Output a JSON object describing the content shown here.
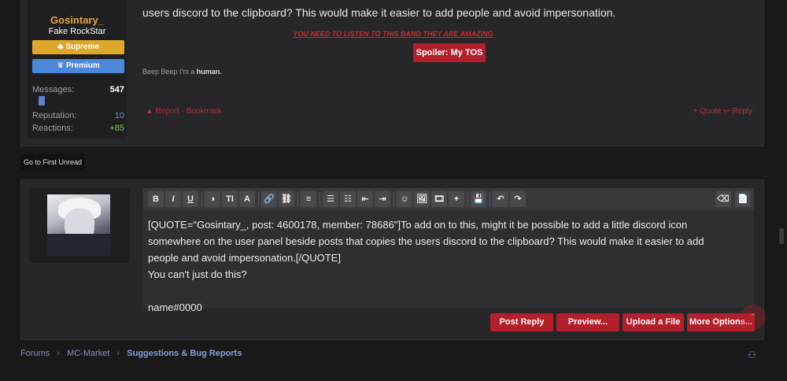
{
  "post": {
    "user": {
      "name": "Gosintary_",
      "title": "Fake RockStar",
      "badges": [
        {
          "label": "Supreme",
          "icon": "diamond-icon"
        },
        {
          "label": "Premium",
          "icon": "trophy-icon"
        }
      ],
      "stats": [
        {
          "label": "Messages:",
          "value": "547"
        },
        {
          "label": "Reputation:",
          "value": "10"
        },
        {
          "label": "Reactions:",
          "value": "+85"
        }
      ]
    },
    "text": "users discord to the clipboard? This would make it easier to add people and avoid impersonation.",
    "signature": {
      "banner": "YOU NEED TO LISTEN TO THIS BAND THEY ARE AMAZING",
      "spoiler_button": "Spoiler: My TOS",
      "beep_prefix": "Beep Beep I'm a",
      "beep_bold": "human."
    },
    "actions_left": [
      "Report",
      "Bookmark"
    ],
    "actions_right": [
      "+ Quote",
      "Reply"
    ]
  },
  "go_first_unread": "Go to First Unread",
  "editor": {
    "toolbar": [
      "B",
      "I",
      "U",
      "◑",
      "TI",
      "A",
      "🔗",
      "⛓",
      "≡",
      "☰",
      "☷",
      "⇤",
      "⇥",
      "☺",
      "🖼",
      "🎞",
      "+",
      "💾",
      "↶",
      "↷",
      "⌫",
      "📄"
    ],
    "content_lines": [
      "[QUOTE=\"Gosintary_, post: 4600178, member: 78686\"]To add on to this, might it be possible to add a little discord icon",
      "somewhere on the user panel beside posts that copies the users discord to the clipboard? This would make it easier to add",
      "people and avoid impersonation.[/QUOTE]",
      "You can't just do this?",
      "",
      "name#0000"
    ]
  },
  "buttons": {
    "post_reply": "Post Reply",
    "preview": "Preview...",
    "upload": "Upload a File",
    "more_options": "More Options..."
  },
  "breadcrumb": [
    {
      "label": "Forums"
    },
    {
      "label": "MC-Market"
    },
    {
      "label": "Suggestions & Bug Reports"
    }
  ],
  "colors": {
    "accent": "#b3202c",
    "username": "#e7a33b",
    "supreme": "#e0a82a",
    "premium": "#4d87d8"
  }
}
